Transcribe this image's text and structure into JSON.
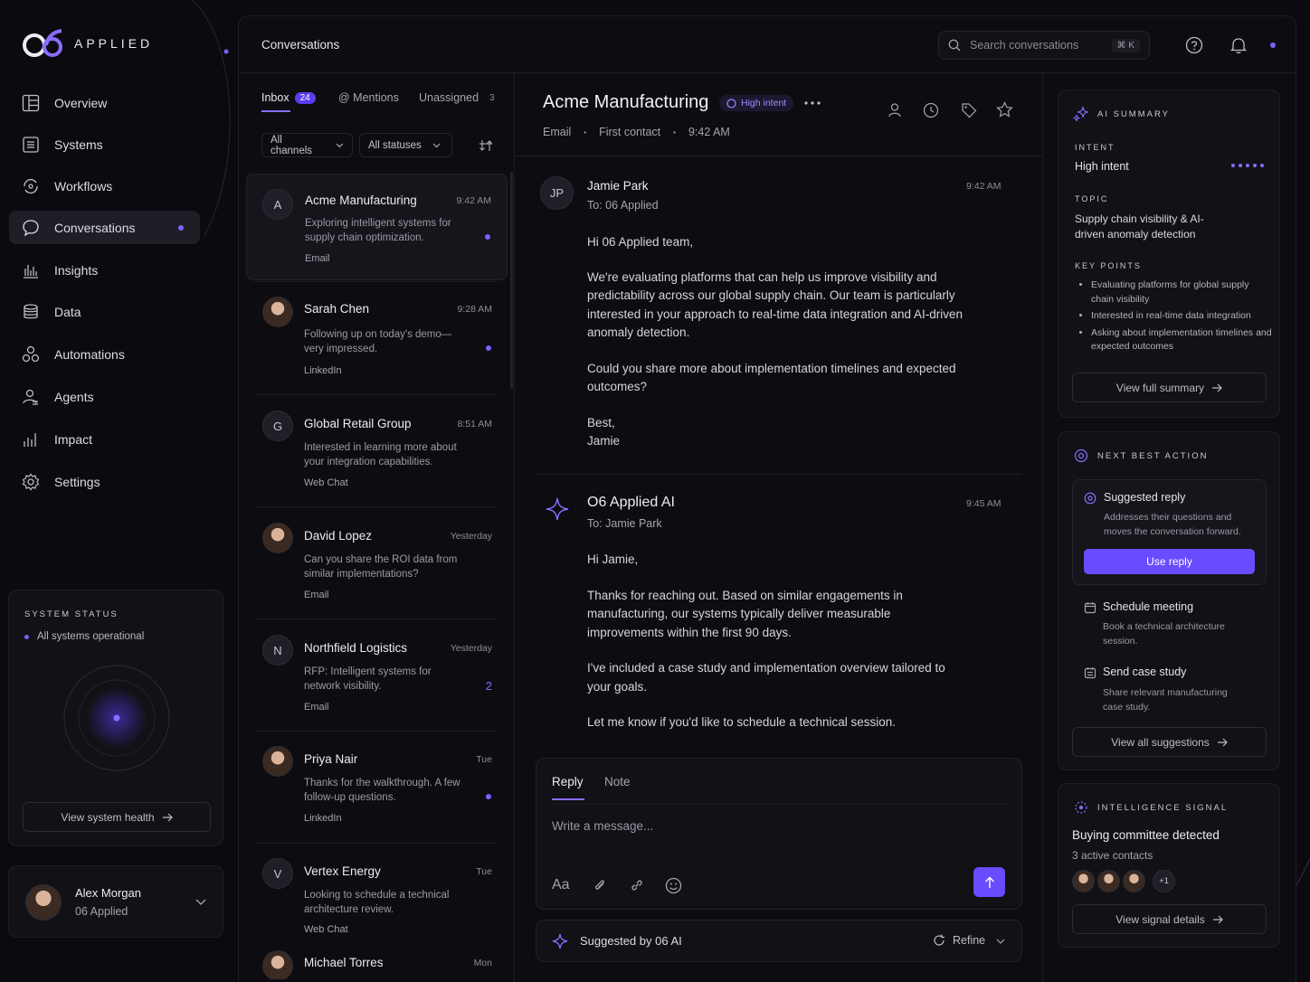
{
  "brand": {
    "logo_mark": "O6",
    "name": "APPLIED",
    "accent": "#6a4bff"
  },
  "sidebar": {
    "items": [
      {
        "label": "Overview",
        "icon": "overview-icon"
      },
      {
        "label": "Systems",
        "icon": "systems-icon"
      },
      {
        "label": "Workflows",
        "icon": "workflows-icon"
      },
      {
        "label": "Conversations",
        "icon": "chat-bubble-icon",
        "active": true
      },
      {
        "label": "Insights",
        "icon": "bar-chart-icon"
      },
      {
        "label": "Data",
        "icon": "database-icon"
      },
      {
        "label": "Automations",
        "icon": "automations-icon"
      },
      {
        "label": "Agents",
        "icon": "agents-icon"
      },
      {
        "label": "Impact",
        "icon": "impact-icon"
      },
      {
        "label": "Settings",
        "icon": "gear-icon"
      }
    ],
    "system_status": {
      "title": "SYSTEM STATUS",
      "status": "All systems operational",
      "button": "View system health"
    },
    "user": {
      "name": "Alex Morgan",
      "org": "06 Applied"
    }
  },
  "topbar": {
    "title": "Conversations",
    "search_placeholder": "Search conversations",
    "shortcut": "⌘ K"
  },
  "inbox": {
    "tabs": [
      {
        "label": "Inbox",
        "count": "24"
      },
      {
        "label": "@ Mentions",
        "count": ""
      },
      {
        "label": "Unassigned",
        "count": "3"
      }
    ],
    "filters": {
      "channels": "All channels",
      "statuses": "All statuses"
    },
    "conversations": [
      {
        "initial": "A",
        "name": "Acme Manufacturing",
        "time": "9:42 AM",
        "preview": "Exploring intelligent systems for supply chain optimization.",
        "channel": "Email",
        "unread": true
      },
      {
        "initial": "",
        "name": "Sarah Chen",
        "time": "9:28 AM",
        "preview": "Following up on today's demo— very impressed.",
        "channel": "LinkedIn",
        "unread": true
      },
      {
        "initial": "G",
        "name": "Global Retail Group",
        "time": "8:51 AM",
        "preview": "Interested in learning more about your integration capabilities.",
        "channel": "Web Chat",
        "unread": false
      },
      {
        "initial": "",
        "name": "David Lopez",
        "time": "Yesterday",
        "preview": "Can you share the ROI data from similar implementations?",
        "channel": "Email",
        "unread": false
      },
      {
        "initial": "N",
        "name": "Northfield Logistics",
        "time": "Yesterday",
        "preview": "RFP: Intelligent systems for network visibility.",
        "channel": "Email",
        "count": "2"
      },
      {
        "initial": "",
        "name": "Priya Nair",
        "time": "Tue",
        "preview": "Thanks for the walkthrough. A few follow-up questions.",
        "channel": "LinkedIn",
        "unread": true
      },
      {
        "initial": "V",
        "name": "Vertex Energy",
        "time": "Tue",
        "preview": "Looking to schedule a technical architecture review.",
        "channel": "Web Chat",
        "unread": false
      },
      {
        "initial": "",
        "name": "Michael Torres",
        "time": "Mon",
        "preview": "",
        "channel": "",
        "unread": false
      }
    ]
  },
  "thread": {
    "title": "Acme Manufacturing",
    "intent_chip": "High intent",
    "meta": [
      "Email",
      "First contact",
      "9:42 AM"
    ],
    "messages": [
      {
        "initials": "JP",
        "sender": "Jamie Park",
        "to": "To:  06 Applied",
        "time": "9:42 AM",
        "paragraphs": [
          "Hi 06 Applied team,",
          "We're evaluating platforms that can help us improve visibility and predictability across our global supply chain. Our team is particularly interested in your approach to real-time data integration and AI-driven anomaly detection.",
          "Could you share more about implementation timelines and expected outcomes?",
          "Best,\nJamie"
        ]
      },
      {
        "initials": "",
        "sender": "O6 Applied AI",
        "to": "To:  Jamie Park",
        "time": "9:45 AM",
        "paragraphs": [
          "Hi Jamie,",
          "Thanks for reaching out. Based on similar engagements in manufacturing, our systems typically deliver measurable improvements within the first 90 days.",
          "I've included a case study and implementation overview tailored to your goals.",
          "Let me know if you'd like to schedule a technical session."
        ]
      }
    ],
    "composer": {
      "tab_reply": "Reply",
      "tab_note": "Note",
      "placeholder": "Write a message...",
      "format_label": "Aa"
    },
    "suggested": {
      "label": "Suggested by 06 AI",
      "refine": "Refine"
    }
  },
  "right": {
    "ai_summary": {
      "title": "AI SUMMARY",
      "intent_label": "INTENT",
      "intent_value": "High intent",
      "topic_label": "TOPIC",
      "topic_value": "Supply chain visibility & AI-driven anomaly detection",
      "key_points_label": "KEY POINTS",
      "key_points": [
        "Evaluating platforms for global supply chain visibility",
        "Interested in real-time data integration",
        "Asking about implementation timelines and expected outcomes"
      ],
      "button": "View full summary"
    },
    "next_best_action": {
      "title": "NEXT BEST ACTION",
      "suggested_title": "Suggested reply",
      "suggested_desc": "Addresses their questions and moves the conversation forward.",
      "use_button": "Use reply",
      "items": [
        {
          "title": "Schedule meeting",
          "desc": "Book a technical architecture session."
        },
        {
          "title": "Send case study",
          "desc": "Share relevant manufacturing case study."
        }
      ],
      "button": "View all suggestions"
    },
    "intelligence_signal": {
      "title": "INTELLIGENCE SIGNAL",
      "headline": "Buying committee detected",
      "sub": "3 active contacts",
      "extra": "+1",
      "button": "View signal details"
    }
  }
}
